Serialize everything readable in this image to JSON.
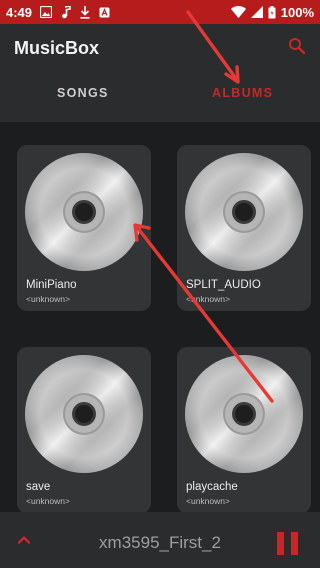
{
  "status_bar": {
    "time": "4:49",
    "battery_text": "100%",
    "background_color": "#b71c1c"
  },
  "header": {
    "app_title": "MusicBox"
  },
  "tabs": [
    {
      "label": "SONGS",
      "selected": false
    },
    {
      "label": "ALBUMS",
      "selected": true
    }
  ],
  "albums": [
    {
      "title": "MiniPiano",
      "artist": "<unknown>"
    },
    {
      "title": "SPLIT_AUDIO",
      "artist": "<unknown>"
    },
    {
      "title": "save",
      "artist": "<unknown>"
    },
    {
      "title": "playcache",
      "artist": "<unknown>"
    }
  ],
  "player": {
    "track_title": "xm3595_First_2",
    "state": "playing"
  },
  "colors": {
    "accent": "#c62828",
    "background": "#1c1d1f",
    "surface": "#2b2c2e",
    "card": "#333436",
    "annotation_arrow": "#e53935"
  },
  "icons": {
    "status_left": [
      "gallery-icon",
      "music-note-icon",
      "download-icon",
      "app-notification-icon"
    ],
    "status_right": [
      "wifi-icon",
      "signal-icon",
      "battery-icon"
    ],
    "header": [
      "search-icon"
    ],
    "player": [
      "chevron-up-icon",
      "pause-icon"
    ],
    "album_art": "compact-disc-icon"
  }
}
